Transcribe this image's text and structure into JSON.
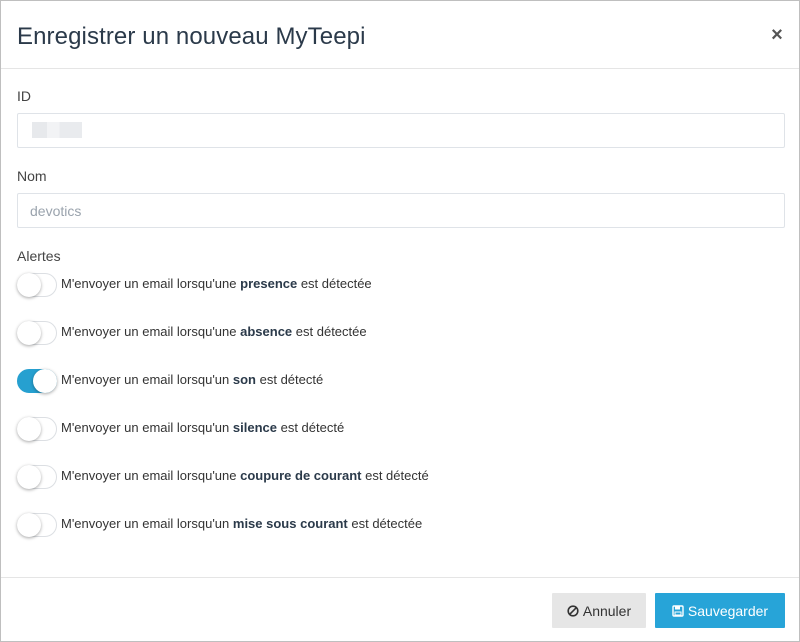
{
  "header": {
    "title": "Enregistrer un nouveau MyTeepi",
    "close_glyph": "×"
  },
  "form": {
    "id_label": "ID",
    "id_value": "",
    "name_label": "Nom",
    "name_value": "devotics",
    "alerts_label": "Alertes"
  },
  "alerts": [
    {
      "prefix": "M'envoyer un email lorsqu'une ",
      "keyword": "presence",
      "suffix": " est détectée",
      "enabled": false
    },
    {
      "prefix": "M'envoyer un email lorsqu'une ",
      "keyword": "absence",
      "suffix": " est détectée",
      "enabled": false
    },
    {
      "prefix": "M'envoyer un email lorsqu'un ",
      "keyword": "son",
      "suffix": " est détecté",
      "enabled": true
    },
    {
      "prefix": "M'envoyer un email lorsqu'un ",
      "keyword": "silence",
      "suffix": " est détecté",
      "enabled": false
    },
    {
      "prefix": "M'envoyer un email lorsqu'une ",
      "keyword": "coupure de courant",
      "suffix": " est détecté",
      "enabled": false
    },
    {
      "prefix": "M'envoyer un email lorsqu'un ",
      "keyword": "mise sous courant",
      "suffix": " est détectée",
      "enabled": false
    }
  ],
  "footer": {
    "cancel_label": "Annuler",
    "save_label": "Sauvegarder"
  },
  "icons": {
    "close": "close-icon",
    "cancel": "ban-icon",
    "save": "floppy-disk-icon"
  },
  "colors": {
    "accent": "#27a4d8",
    "toggle_on": "#26a0d0",
    "cancel_bg": "#e6e6e6",
    "title": "#2b3a4a"
  }
}
